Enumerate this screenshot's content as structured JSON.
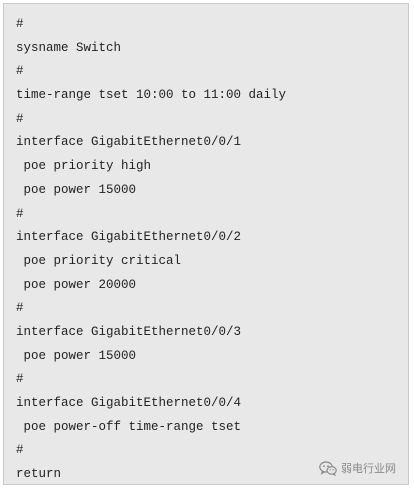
{
  "code_block": {
    "lines": [
      "#",
      "sysname Switch",
      "#",
      "time-range tset 10:00 to 11:00 daily",
      "#",
      "interface GigabitEthernet0/0/1",
      " poe priority high",
      " poe power 15000",
      "#",
      "interface GigabitEthernet0/0/2",
      " poe priority critical",
      " poe power 20000",
      "#",
      "interface GigabitEthernet0/0/3",
      " poe power 15000",
      "#",
      "interface GigabitEthernet0/0/4",
      " poe power-off time-range tset",
      "#",
      "return"
    ]
  },
  "watermark": {
    "icon": "wechat-icon",
    "text": "弱电行业网"
  }
}
